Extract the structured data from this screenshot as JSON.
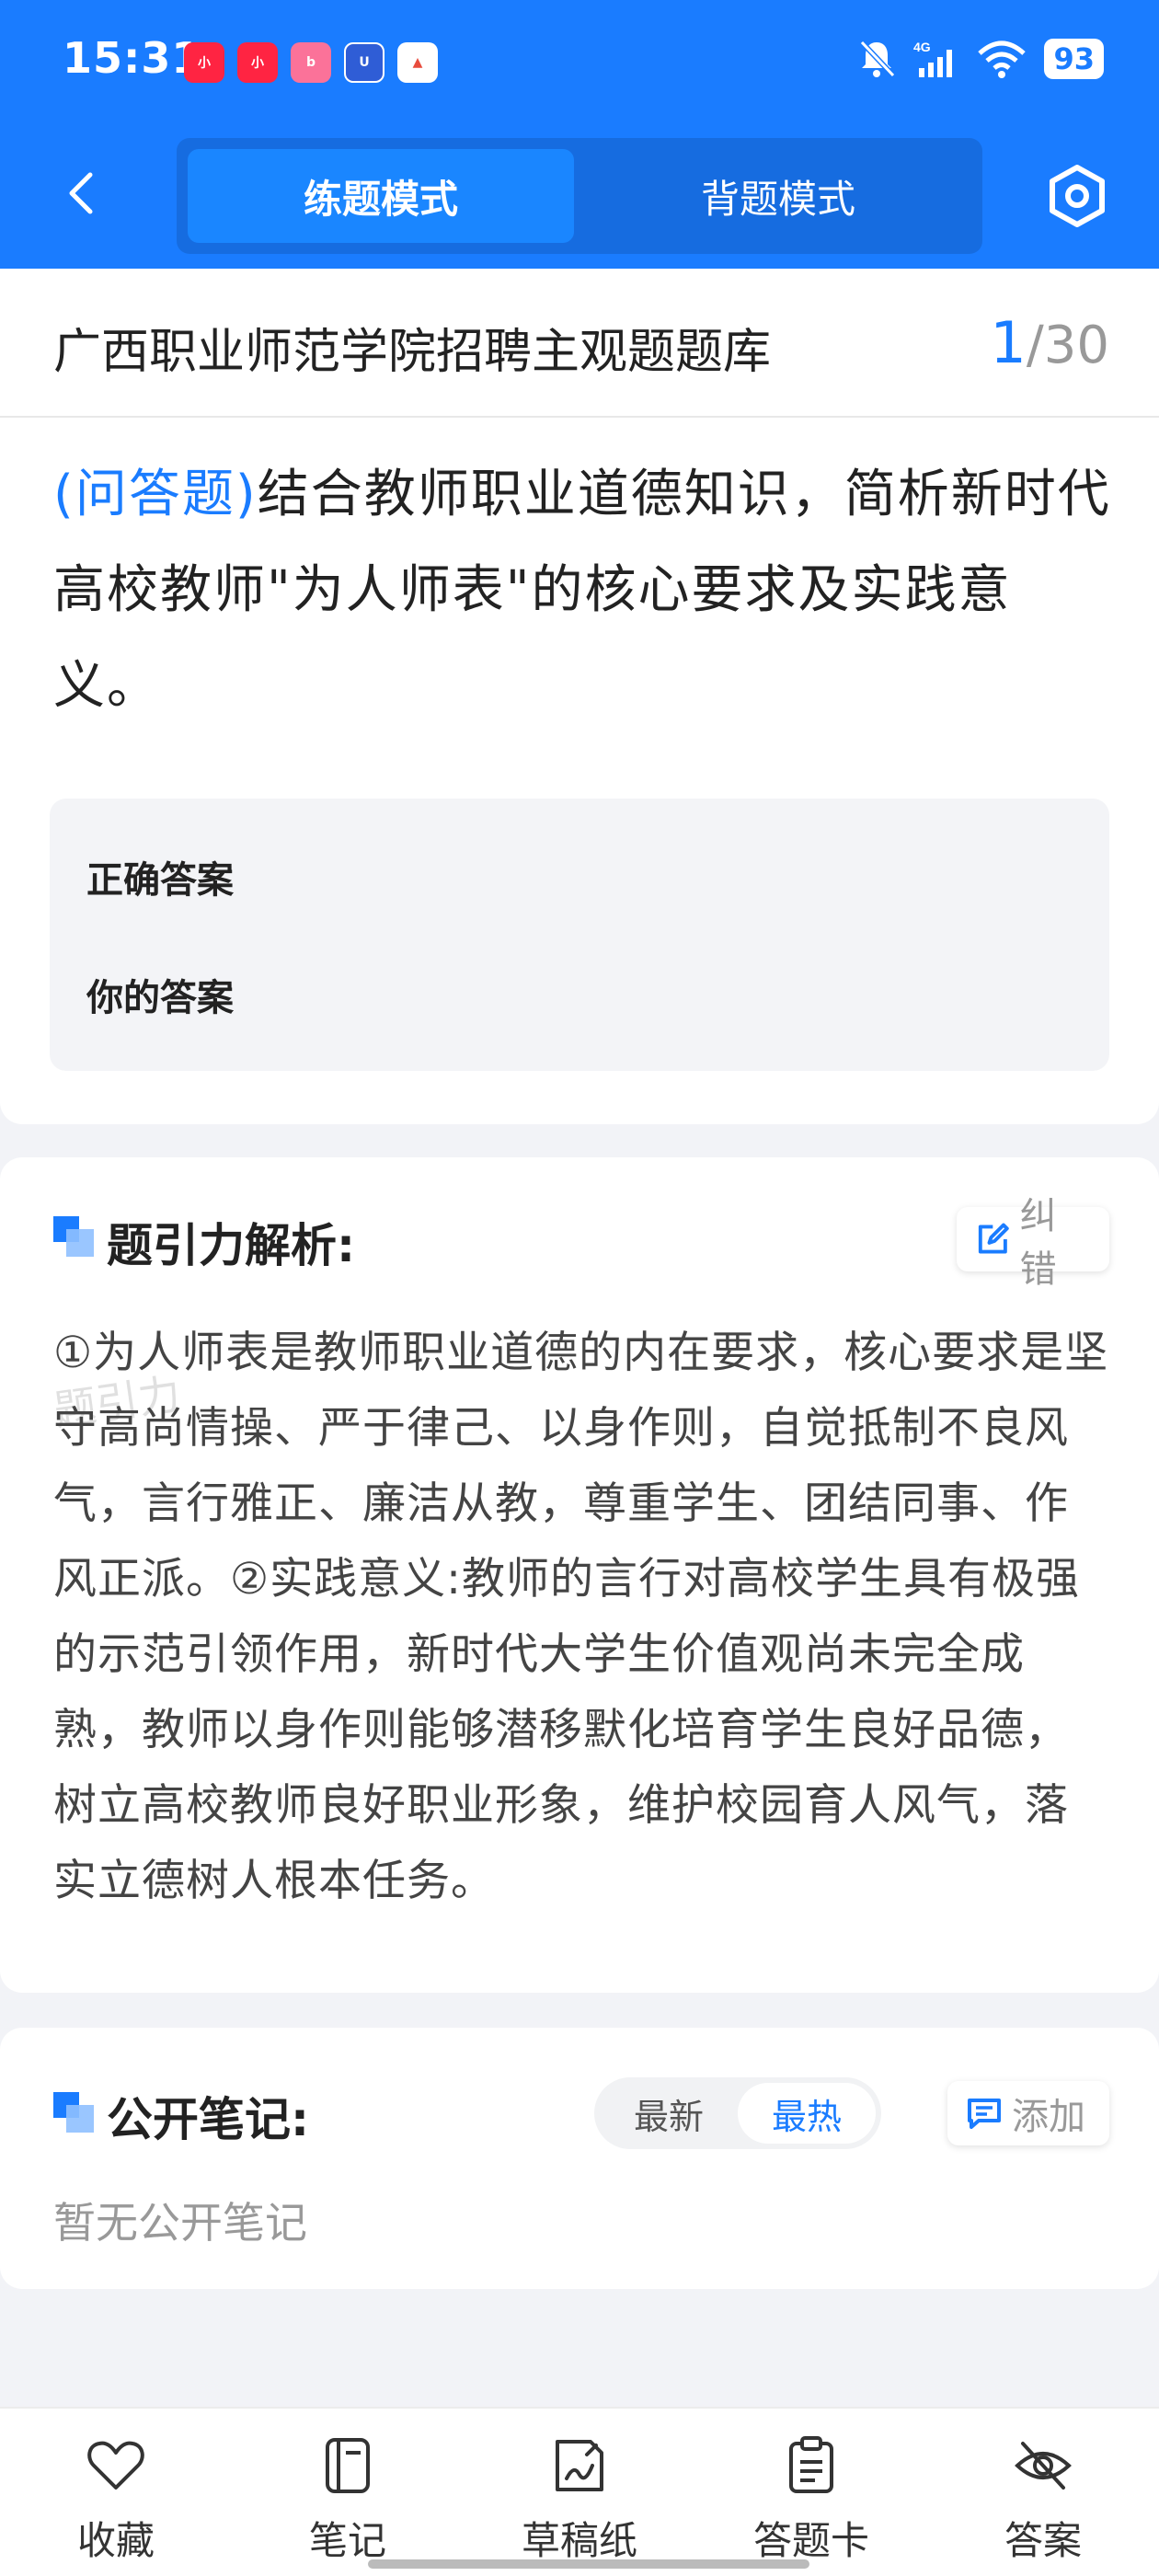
{
  "status_bar": {
    "time": "15:31",
    "battery": "93",
    "network": "4G",
    "app_icons": [
      "xiaohongshu-icon",
      "xiaohongshu-icon",
      "bilibili-icon",
      "app-icon",
      "app-icon"
    ]
  },
  "nav": {
    "tabs": [
      {
        "label": "练题模式",
        "active": true
      },
      {
        "label": "背题模式",
        "active": false
      }
    ]
  },
  "question_bank": {
    "title": "广西职业师范学院招聘主观题题库",
    "current": "1",
    "separator": "/",
    "total": "30"
  },
  "question": {
    "type_label": "(问答题)",
    "text": "结合教师职业道德知识，简析新时代高校教师\"为人师表\"的核心要求及实践意义。",
    "correct_answer_label": "正确答案",
    "your_answer_label": "你的答案"
  },
  "analysis": {
    "title": "题引力解析:",
    "report_label": "纠错",
    "watermark": "题引力",
    "text": "①为人师表是教师职业道德的内在要求，核心要求是坚守高尚情操、严于律己、以身作则，自觉抵制不良风气，言行雅正、廉洁从教，尊重学生、团结同事、作风正派。②实践意义:教师的言行对高校学生具有极强的示范引领作用，新时代大学生价值观尚未完全成熟，教师以身作则能够潜移默化培育学生良好品德，树立高校教师良好职业形象，维护校园育人风气，落实立德树人根本任务。"
  },
  "notes": {
    "title": "公开笔记:",
    "sort_newest": "最新",
    "sort_hottest": "最热",
    "add_label": "添加",
    "empty_text": "暂无公开笔记"
  },
  "bottom_bar": {
    "items": [
      {
        "label": "收藏",
        "icon": "heart-icon"
      },
      {
        "label": "笔记",
        "icon": "notebook-icon"
      },
      {
        "label": "草稿纸",
        "icon": "draft-icon"
      },
      {
        "label": "答题卡",
        "icon": "clipboard-icon"
      },
      {
        "label": "答案",
        "icon": "eye-off-icon"
      }
    ]
  },
  "colors": {
    "primary": "#1a7cff",
    "background": "#f2f3f7"
  }
}
